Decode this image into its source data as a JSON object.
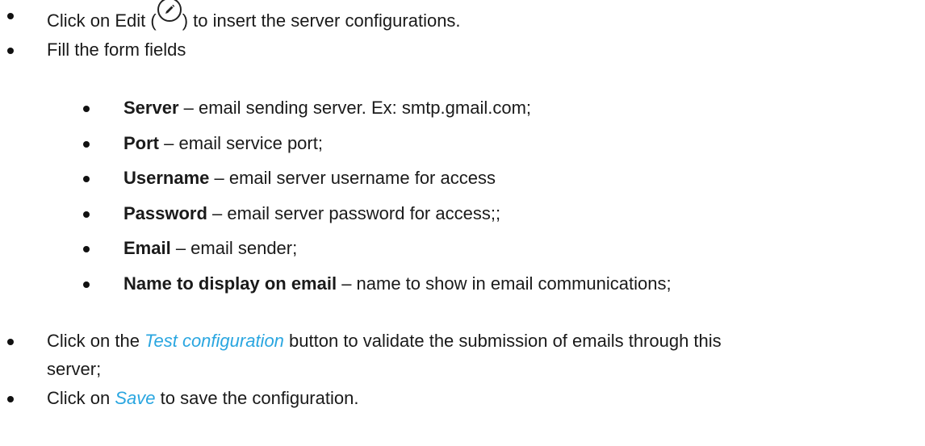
{
  "steps": {
    "click_edit": {
      "before": "Click on Edit (",
      "icon": "pencil-edit-icon",
      "after": ") to insert the server configurations."
    },
    "fill_form": "Fill the form fields",
    "fields": [
      {
        "name": "Server",
        "desc": " – email sending server. Ex: smtp.gmail.com;"
      },
      {
        "name": "Port",
        "desc": " – email service port;"
      },
      {
        "name": "Username",
        "desc": " – email server username for access"
      },
      {
        "name": "Password",
        "desc": " – email server password for access;;"
      },
      {
        "name": "Email",
        "desc": " – email sender;"
      },
      {
        "name": "Name to display on email",
        "desc": "  – name to show in email communications;"
      }
    ],
    "test": {
      "before": "Click on the ",
      "link": "Test configuration",
      "after": " button to validate the submission of emails through this",
      "continuation": "server;"
    },
    "save": {
      "before": "Click on ",
      "link": "Save",
      "after": " to save the configuration."
    }
  },
  "colors": {
    "text": "#1a1a1a",
    "highlight": "#2aa6e0"
  }
}
